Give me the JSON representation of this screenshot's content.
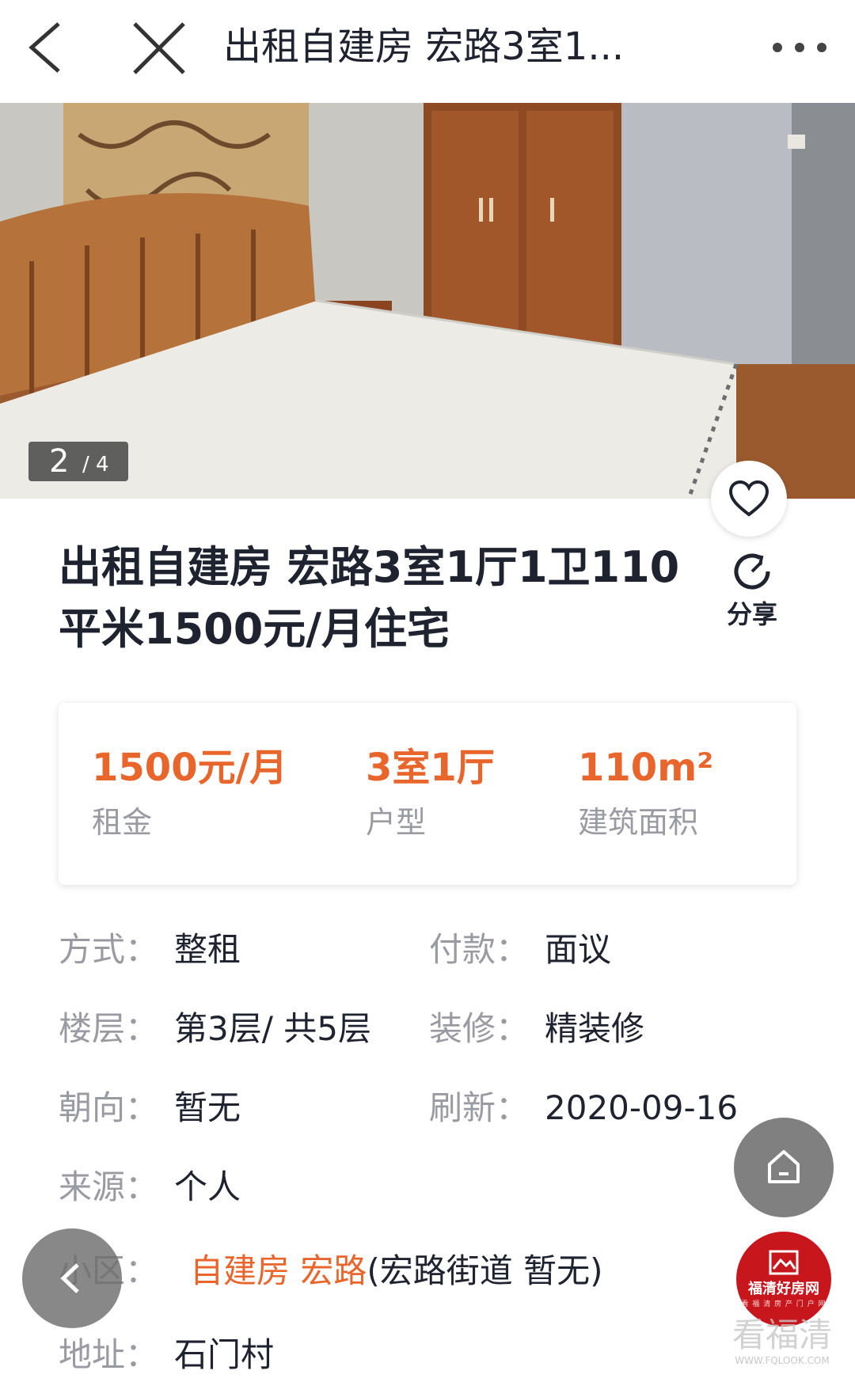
{
  "topbar": {
    "title": "出租自建房 宏路3室1...",
    "back_icon": "chevron-left-icon",
    "close_icon": "close-icon",
    "more_icon": "more-dots-icon"
  },
  "gallery": {
    "current": "2",
    "total": "/ 4"
  },
  "listing": {
    "title": "出租自建房 宏路3室1厅1卫110平米1500元/月住宅",
    "share_label": "分享"
  },
  "summary": [
    {
      "value": "1500元/月",
      "label": "租金"
    },
    {
      "value": "3室1厅",
      "label": "户型"
    },
    {
      "value": "110m²",
      "label": "建筑面积"
    }
  ],
  "details": {
    "mode": {
      "label": "方式：",
      "value": "整租"
    },
    "payment": {
      "label": "付款：",
      "value": "面议"
    },
    "floor": {
      "label": "楼层：",
      "value": "第3层/ 共5层"
    },
    "decoration": {
      "label": "装修：",
      "value": "精装修"
    },
    "orientation": {
      "label": "朝向：",
      "value": "暂无"
    },
    "refresh": {
      "label": "刷新：",
      "value": "2020-09-16"
    },
    "source": {
      "label": "来源：",
      "value": "个人"
    },
    "community": {
      "label": "小区：",
      "value_link": "自建房 宏路",
      "value_rest": "(宏路街道 暂无)"
    },
    "address": {
      "label": "地址：",
      "value": "石门村"
    }
  },
  "brand": {
    "name": "福清好房网",
    "sub": "看 福 清 房 产 门 户 网"
  },
  "watermark": {
    "big": "看福清",
    "small": "WWW.FQLOOK.COM"
  },
  "colors": {
    "accent": "#e8652c",
    "brand": "#c8161d",
    "muted": "#9a9aa2",
    "text": "#1f2330"
  }
}
